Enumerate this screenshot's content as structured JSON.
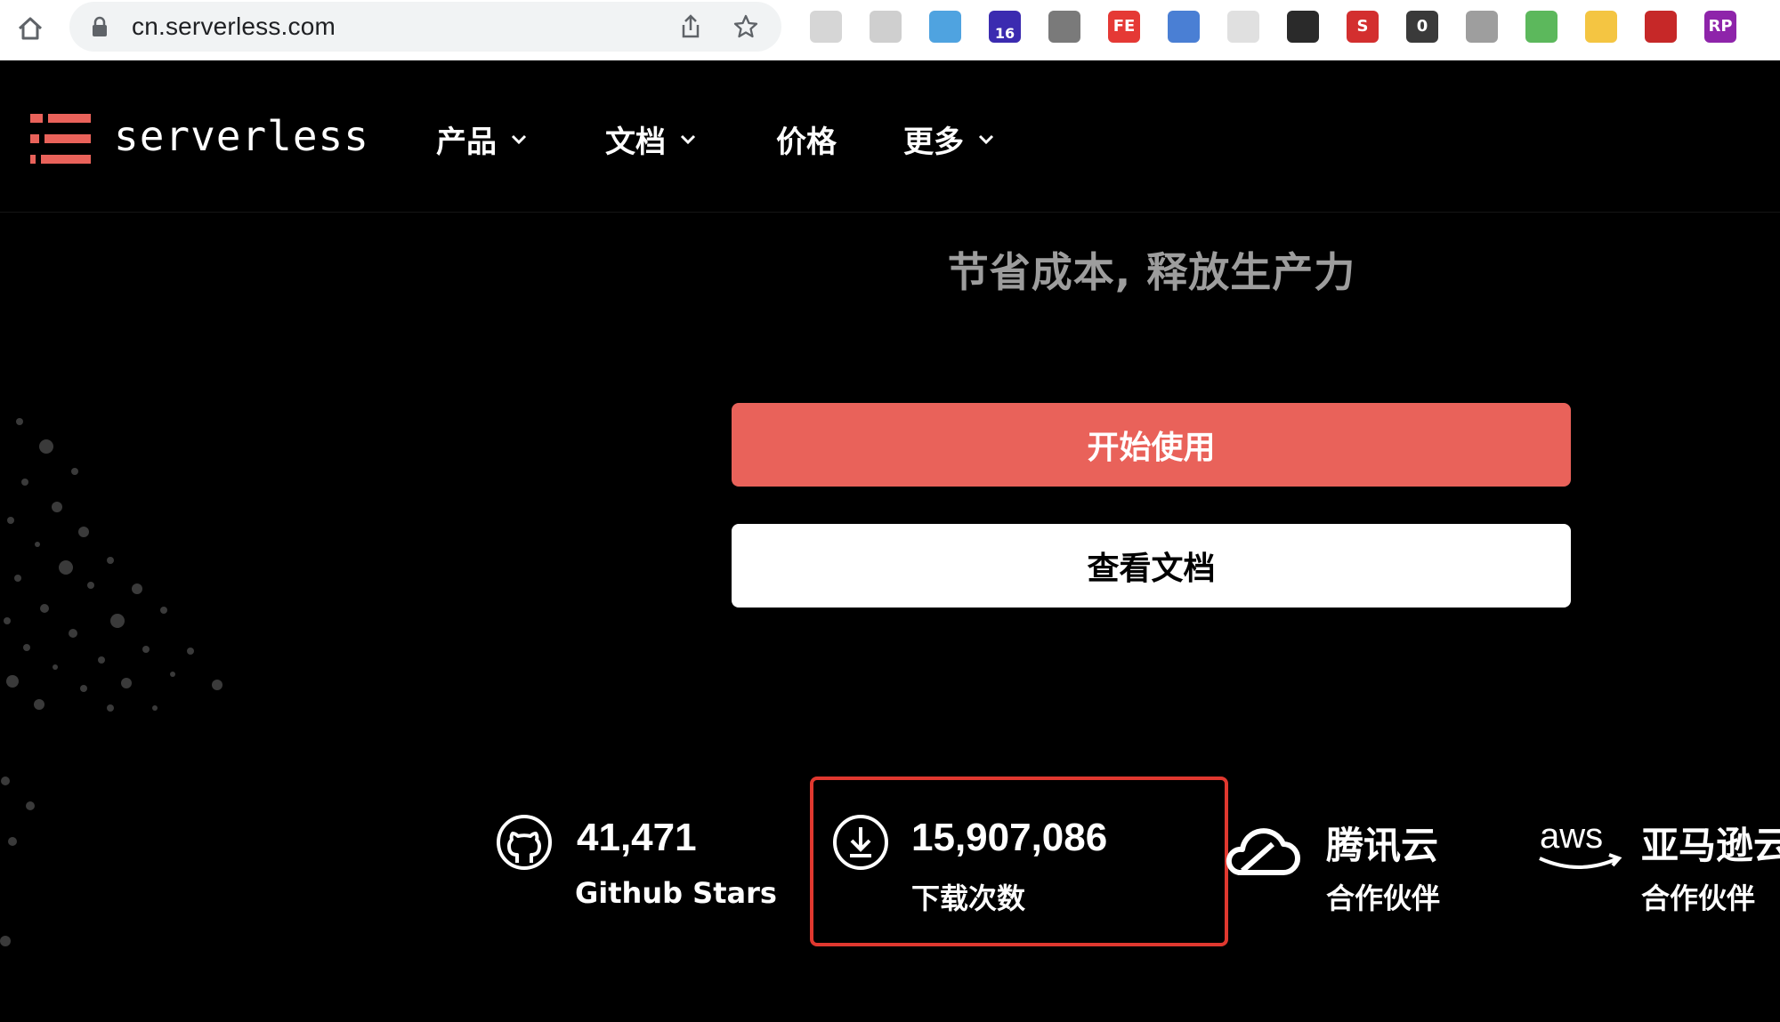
{
  "browser": {
    "url": "cn.serverless.com",
    "extensions": [
      {
        "icon": "react-devtools-icon",
        "text": "",
        "color": "#d6d6d6"
      },
      {
        "icon": "target-icon",
        "text": "",
        "color": "#cfcfcf"
      },
      {
        "icon": "wave-icon",
        "text": "",
        "color": "#4fa3e0"
      },
      {
        "icon": "graduation-cap-icon",
        "text": "16",
        "color": "#3b2bb0"
      },
      {
        "icon": "wrench-icon",
        "text": "",
        "color": "#7a7a7a"
      },
      {
        "icon": "fe-icon",
        "text": "FE",
        "color": "#e53935"
      },
      {
        "icon": "magnifier-icon",
        "text": "",
        "color": "#4a7fd4"
      },
      {
        "icon": "note-icon",
        "text": "",
        "color": "#e0e0e0"
      },
      {
        "icon": "eyedropper-icon",
        "text": "",
        "color": "#2a2a2a"
      },
      {
        "icon": "s-icon",
        "text": "S",
        "color": "#d32f2f"
      },
      {
        "icon": "zero-icon",
        "text": "0",
        "color": "#3a3a3a"
      },
      {
        "icon": "vue-icon",
        "text": "",
        "color": "#9e9e9e"
      },
      {
        "icon": "diamond-icon",
        "text": "",
        "color": "#5cb85c"
      },
      {
        "icon": "download-arrow-icon",
        "text": "",
        "color": "#f4c542"
      },
      {
        "icon": "red-shape-icon",
        "text": "",
        "color": "#c62828"
      },
      {
        "icon": "rp-icon",
        "text": "RP",
        "color": "#8e24aa"
      }
    ]
  },
  "header": {
    "brand": "serverless",
    "nav": [
      {
        "label": "产品",
        "has_dropdown": true
      },
      {
        "label": "文档",
        "has_dropdown": true
      },
      {
        "label": "价格",
        "has_dropdown": false
      },
      {
        "label": "更多",
        "has_dropdown": true
      }
    ]
  },
  "hero": {
    "tagline": "节省成本, 释放生产力",
    "primary_button": "开始使用",
    "secondary_button": "查看文档"
  },
  "stats": [
    {
      "icon": "github-icon",
      "value": "41,471",
      "label": "Github Stars"
    },
    {
      "icon": "download-icon",
      "value": "15,907,086",
      "label": "下载次数"
    },
    {
      "icon": "tencent-cloud-icon",
      "value": "腾讯云",
      "label": "合作伙伴"
    },
    {
      "icon": "aws-icon",
      "value": "亚马逊云",
      "label": "合作伙伴"
    }
  ],
  "colors": {
    "accent": "#e9625a",
    "highlight": "#e0382f",
    "background": "#000000"
  }
}
